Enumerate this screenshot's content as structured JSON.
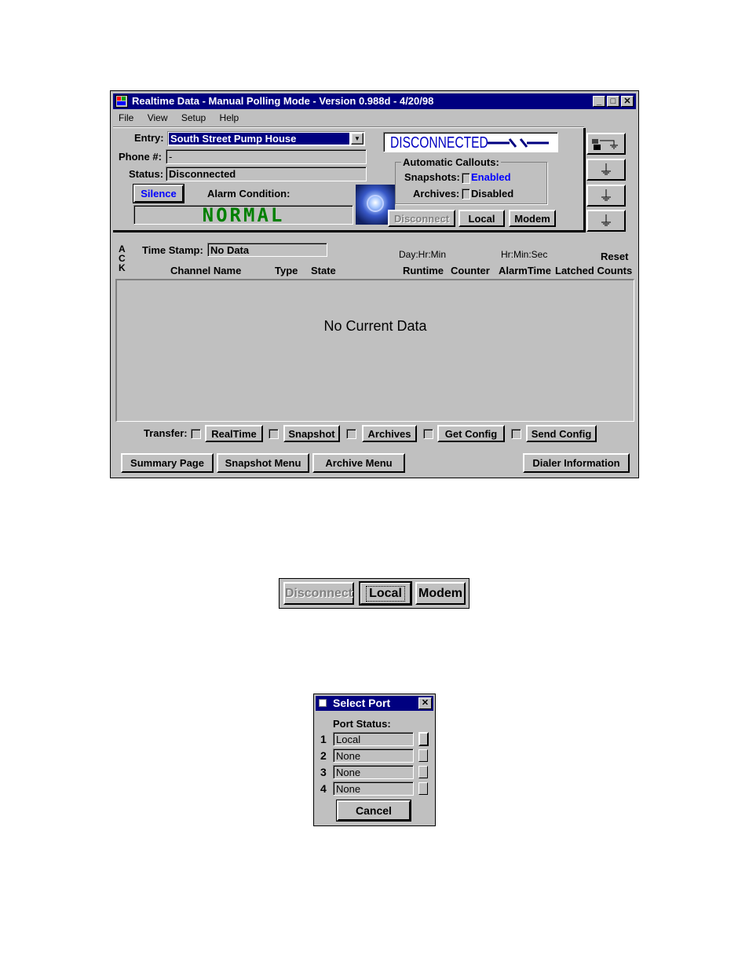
{
  "window": {
    "title": "Realtime Data - Manual Polling Mode - Version 0.988d - 4/20/98",
    "controls": {
      "minimize": "_",
      "maximize": "□",
      "close": "✕"
    }
  },
  "menu": [
    "File",
    "View",
    "Setup",
    "Help"
  ],
  "entry": {
    "label": "Entry:",
    "value": "South Street Pump House"
  },
  "phone": {
    "label": "Phone #:",
    "value": "-"
  },
  "status": {
    "label": "Status:",
    "value": "Disconnected"
  },
  "silence_label": "Silence",
  "alarm": {
    "label": "Alarm Condition:",
    "value": "NORMAL"
  },
  "connection": {
    "text": "DISCONNECTED"
  },
  "callouts": {
    "title": "Automatic Callouts:",
    "snapshots_label": "Snapshots:",
    "snapshots_value": "Enabled",
    "archives_label": "Archives:",
    "archives_value": "Disabled"
  },
  "connect_buttons": {
    "disconnect": "Disconnect",
    "local": "Local",
    "modem": "Modem"
  },
  "table": {
    "ack": [
      "A",
      "C",
      "K"
    ],
    "timestamp_label": "Time Stamp:",
    "timestamp_value": "No Data",
    "day_hr_min": "Day:Hr:Min",
    "hr_min_sec": "Hr:Min:Sec",
    "reset": "Reset",
    "columns": [
      "Channel Name",
      "Type",
      "State",
      "Runtime",
      "Counter",
      "AlarmTime",
      "Latched Counts"
    ],
    "empty_message": "No Current Data"
  },
  "transfer": {
    "label": "Transfer:",
    "buttons": [
      "RealTime",
      "Snapshot",
      "Archives",
      "Get Config",
      "Send Config"
    ]
  },
  "bottom_buttons": {
    "summary": "Summary Page",
    "snapshot_menu": "Snapshot Menu",
    "archive_menu": "Archive Menu",
    "dialer": "Dialer Information"
  },
  "zoom_buttons": {
    "disconnect": "Disconnect",
    "local": "Local",
    "modem": "Modem"
  },
  "select_port": {
    "title": "Select Port",
    "close": "✕",
    "status_label": "Port Status:",
    "ports": [
      {
        "num": "1",
        "value": "Local"
      },
      {
        "num": "2",
        "value": "None"
      },
      {
        "num": "3",
        "value": "None"
      },
      {
        "num": "4",
        "value": "None"
      }
    ],
    "cancel": "Cancel"
  }
}
